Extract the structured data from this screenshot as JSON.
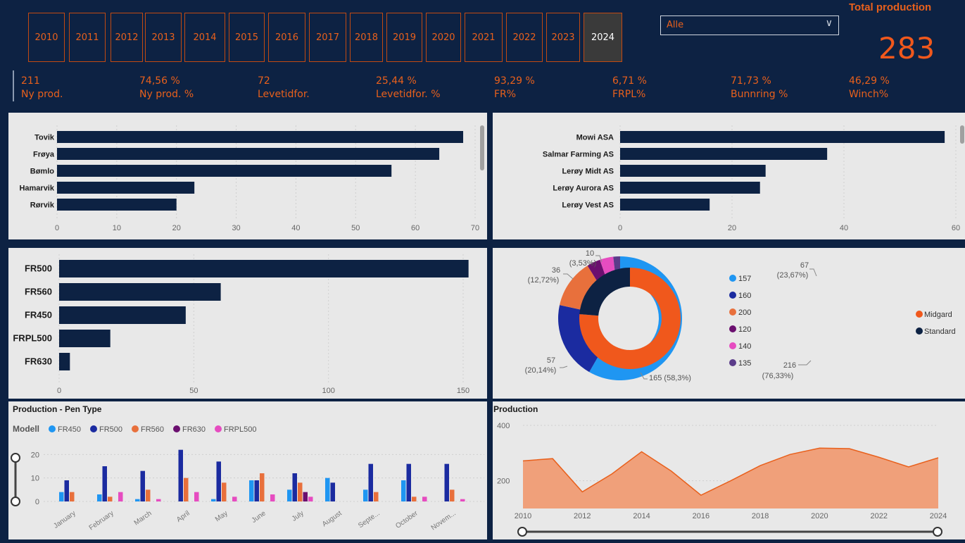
{
  "header": {
    "years": [
      "2010",
      "2011",
      "2012",
      "2013",
      "2014",
      "2015",
      "2016",
      "2017",
      "2018",
      "2019",
      "2020",
      "2021",
      "2022",
      "2023",
      "2024"
    ],
    "selected_year": "2024",
    "dropdown_value": "Alle",
    "total_title": "Total production",
    "total_value": "283",
    "kpis": [
      {
        "value": "211",
        "label": "Ny prod."
      },
      {
        "value": "74,56 %",
        "label": "Ny prod. %"
      },
      {
        "value": "72",
        "label": "Levetidfor."
      },
      {
        "value": "25,44 %",
        "label": "Levetidfor. %"
      },
      {
        "value": "93,29 %",
        "label": "FR%"
      },
      {
        "value": "6,71 %",
        "label": "FRPL%"
      },
      {
        "value": "71,73 %",
        "label": "Bunnring %"
      },
      {
        "value": "46,29 %",
        "label": "Winch%"
      }
    ]
  },
  "colors": {
    "navy": "#0d2243",
    "orange": "#e8601c",
    "panel": "#e8e8e8"
  },
  "chart_data": [
    {
      "type": "bar",
      "orientation": "horizontal",
      "categories": [
        "Tovik",
        "Frøya",
        "Bømlo",
        "Hamarvik",
        "Rørvik"
      ],
      "values": [
        68,
        64,
        56,
        23,
        20
      ],
      "xticks": [
        "0",
        "10",
        "20",
        "30",
        "40",
        "50",
        "60",
        "70"
      ],
      "xlim": [
        0,
        70
      ]
    },
    {
      "type": "bar",
      "orientation": "horizontal",
      "categories": [
        "Mowi ASA",
        "Salmar Farming AS",
        "Lerøy Midt AS",
        "Lerøy Aurora AS",
        "Lerøy Vest AS"
      ],
      "values": [
        58,
        37,
        26,
        25,
        16
      ],
      "xticks": [
        "0",
        "20",
        "40",
        "60"
      ],
      "xlim": [
        0,
        60
      ]
    },
    {
      "type": "bar",
      "orientation": "horizontal",
      "categories": [
        "FR500",
        "FR560",
        "FR450",
        "FRPL500",
        "FR630"
      ],
      "values": [
        152,
        60,
        47,
        19,
        4
      ],
      "xticks": [
        "0",
        "50",
        "100",
        "150"
      ],
      "xlim": [
        0,
        150
      ]
    },
    {
      "type": "pie",
      "donut": true,
      "labels": [
        "157",
        "160",
        "200",
        "120",
        "140",
        "135"
      ],
      "values": [
        165,
        57,
        36,
        10,
        10,
        5
      ],
      "colors": [
        "#1f96f2",
        "#1b2ba0",
        "#e8703c",
        "#6b0f6f",
        "#e64cc0",
        "#5b3c8a"
      ],
      "data_labels": [
        {
          "value": "165",
          "pct": "(58,3%)"
        },
        {
          "value": "57",
          "pct": "(20,14%)"
        },
        {
          "value": "36",
          "pct": "(12,72%)"
        },
        {
          "value": "10",
          "pct": "(3,53%)"
        }
      ]
    },
    {
      "type": "pie",
      "donut": true,
      "labels": [
        "Midgard",
        "Standard"
      ],
      "values": [
        216,
        67
      ],
      "colors": [
        "#f0581c",
        "#0d2243"
      ],
      "data_labels": [
        {
          "value": "216",
          "pct": "(76,33%)"
        },
        {
          "value": "67",
          "pct": "(23,67%)"
        }
      ]
    },
    {
      "type": "bar",
      "grouped": true,
      "title": "Production - Pen Type",
      "legend_title": "Modell",
      "categories": [
        "January",
        "February",
        "March",
        "April",
        "May",
        "June",
        "July",
        "August",
        "Septe...",
        "October",
        "Novem..."
      ],
      "series": [
        {
          "name": "FR450",
          "color": "#1f96f2",
          "values": [
            4,
            3,
            1,
            0,
            1,
            9,
            5,
            10,
            5,
            9,
            0
          ]
        },
        {
          "name": "FR500",
          "color": "#1b2ba0",
          "values": [
            9,
            15,
            13,
            22,
            17,
            9,
            12,
            8,
            16,
            16,
            16
          ]
        },
        {
          "name": "FR560",
          "color": "#e8703c",
          "values": [
            4,
            2,
            5,
            10,
            8,
            12,
            8,
            0,
            4,
            2,
            5
          ]
        },
        {
          "name": "FR630",
          "color": "#6b0f6f",
          "values": [
            0,
            0,
            0,
            0,
            0,
            0,
            4,
            0,
            0,
            0,
            0
          ]
        },
        {
          "name": "FRPL500",
          "color": "#e64cc0",
          "values": [
            0,
            4,
            1,
            4,
            2,
            3,
            2,
            0,
            0,
            2,
            1
          ]
        }
      ],
      "yticks": [
        "0",
        "10",
        "20"
      ],
      "ylim": [
        0,
        24
      ]
    },
    {
      "type": "area",
      "title": "Production",
      "x": [
        2010,
        2011,
        2012,
        2013,
        2014,
        2015,
        2016,
        2017,
        2018,
        2019,
        2020,
        2021,
        2022,
        2023,
        2024
      ],
      "values": [
        272,
        280,
        160,
        225,
        305,
        235,
        148,
        200,
        255,
        295,
        318,
        316,
        285,
        250,
        283
      ],
      "xticks": [
        "2010",
        "2012",
        "2014",
        "2016",
        "2018",
        "2020",
        "2022",
        "2024"
      ],
      "yticks": [
        "200",
        "400"
      ],
      "ylim": [
        100,
        400
      ]
    }
  ]
}
